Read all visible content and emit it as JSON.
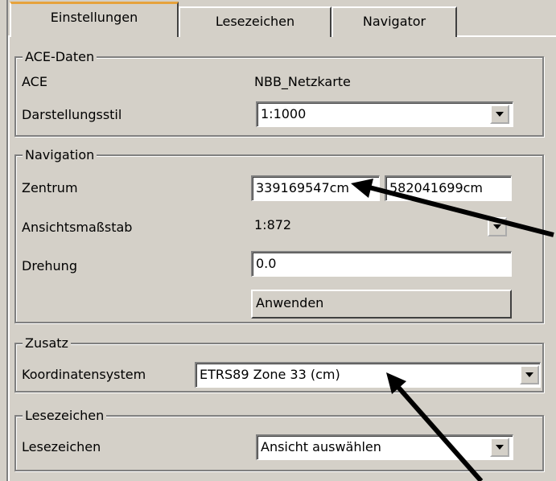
{
  "tabs": [
    {
      "label": "Einstellungen"
    },
    {
      "label": "Lesezeichen"
    },
    {
      "label": "Navigator"
    }
  ],
  "ace_data": {
    "legend": "ACE-Daten",
    "ace_label": "ACE",
    "ace_value": "NBB_Netzkarte",
    "style_label": "Darstellungsstil",
    "style_value": "1:1000"
  },
  "navigation": {
    "legend": "Navigation",
    "center_label": "Zentrum",
    "center_x": "339169547cm",
    "center_y": "582041699cm",
    "scale_label": "Ansichtsmaßstab",
    "scale_value": "1:872",
    "rotation_label": "Drehung",
    "rotation_value": "0.0",
    "apply_button": "Anwenden"
  },
  "extra": {
    "legend": "Zusatz",
    "crs_label": "Koordinatensystem",
    "crs_value": "ETRS89 Zone 33 (cm)"
  },
  "bookmarks": {
    "legend": "Lesezeichen",
    "label": "Lesezeichen",
    "value": "Ansicht auswählen"
  },
  "icons": {
    "dropdown": "chevron-down-icon",
    "annotation": "arrow-annotation"
  },
  "colors": {
    "background": "#d4d0c8",
    "active_tab_accent": "#e6a23c",
    "field": "#ffffff"
  }
}
